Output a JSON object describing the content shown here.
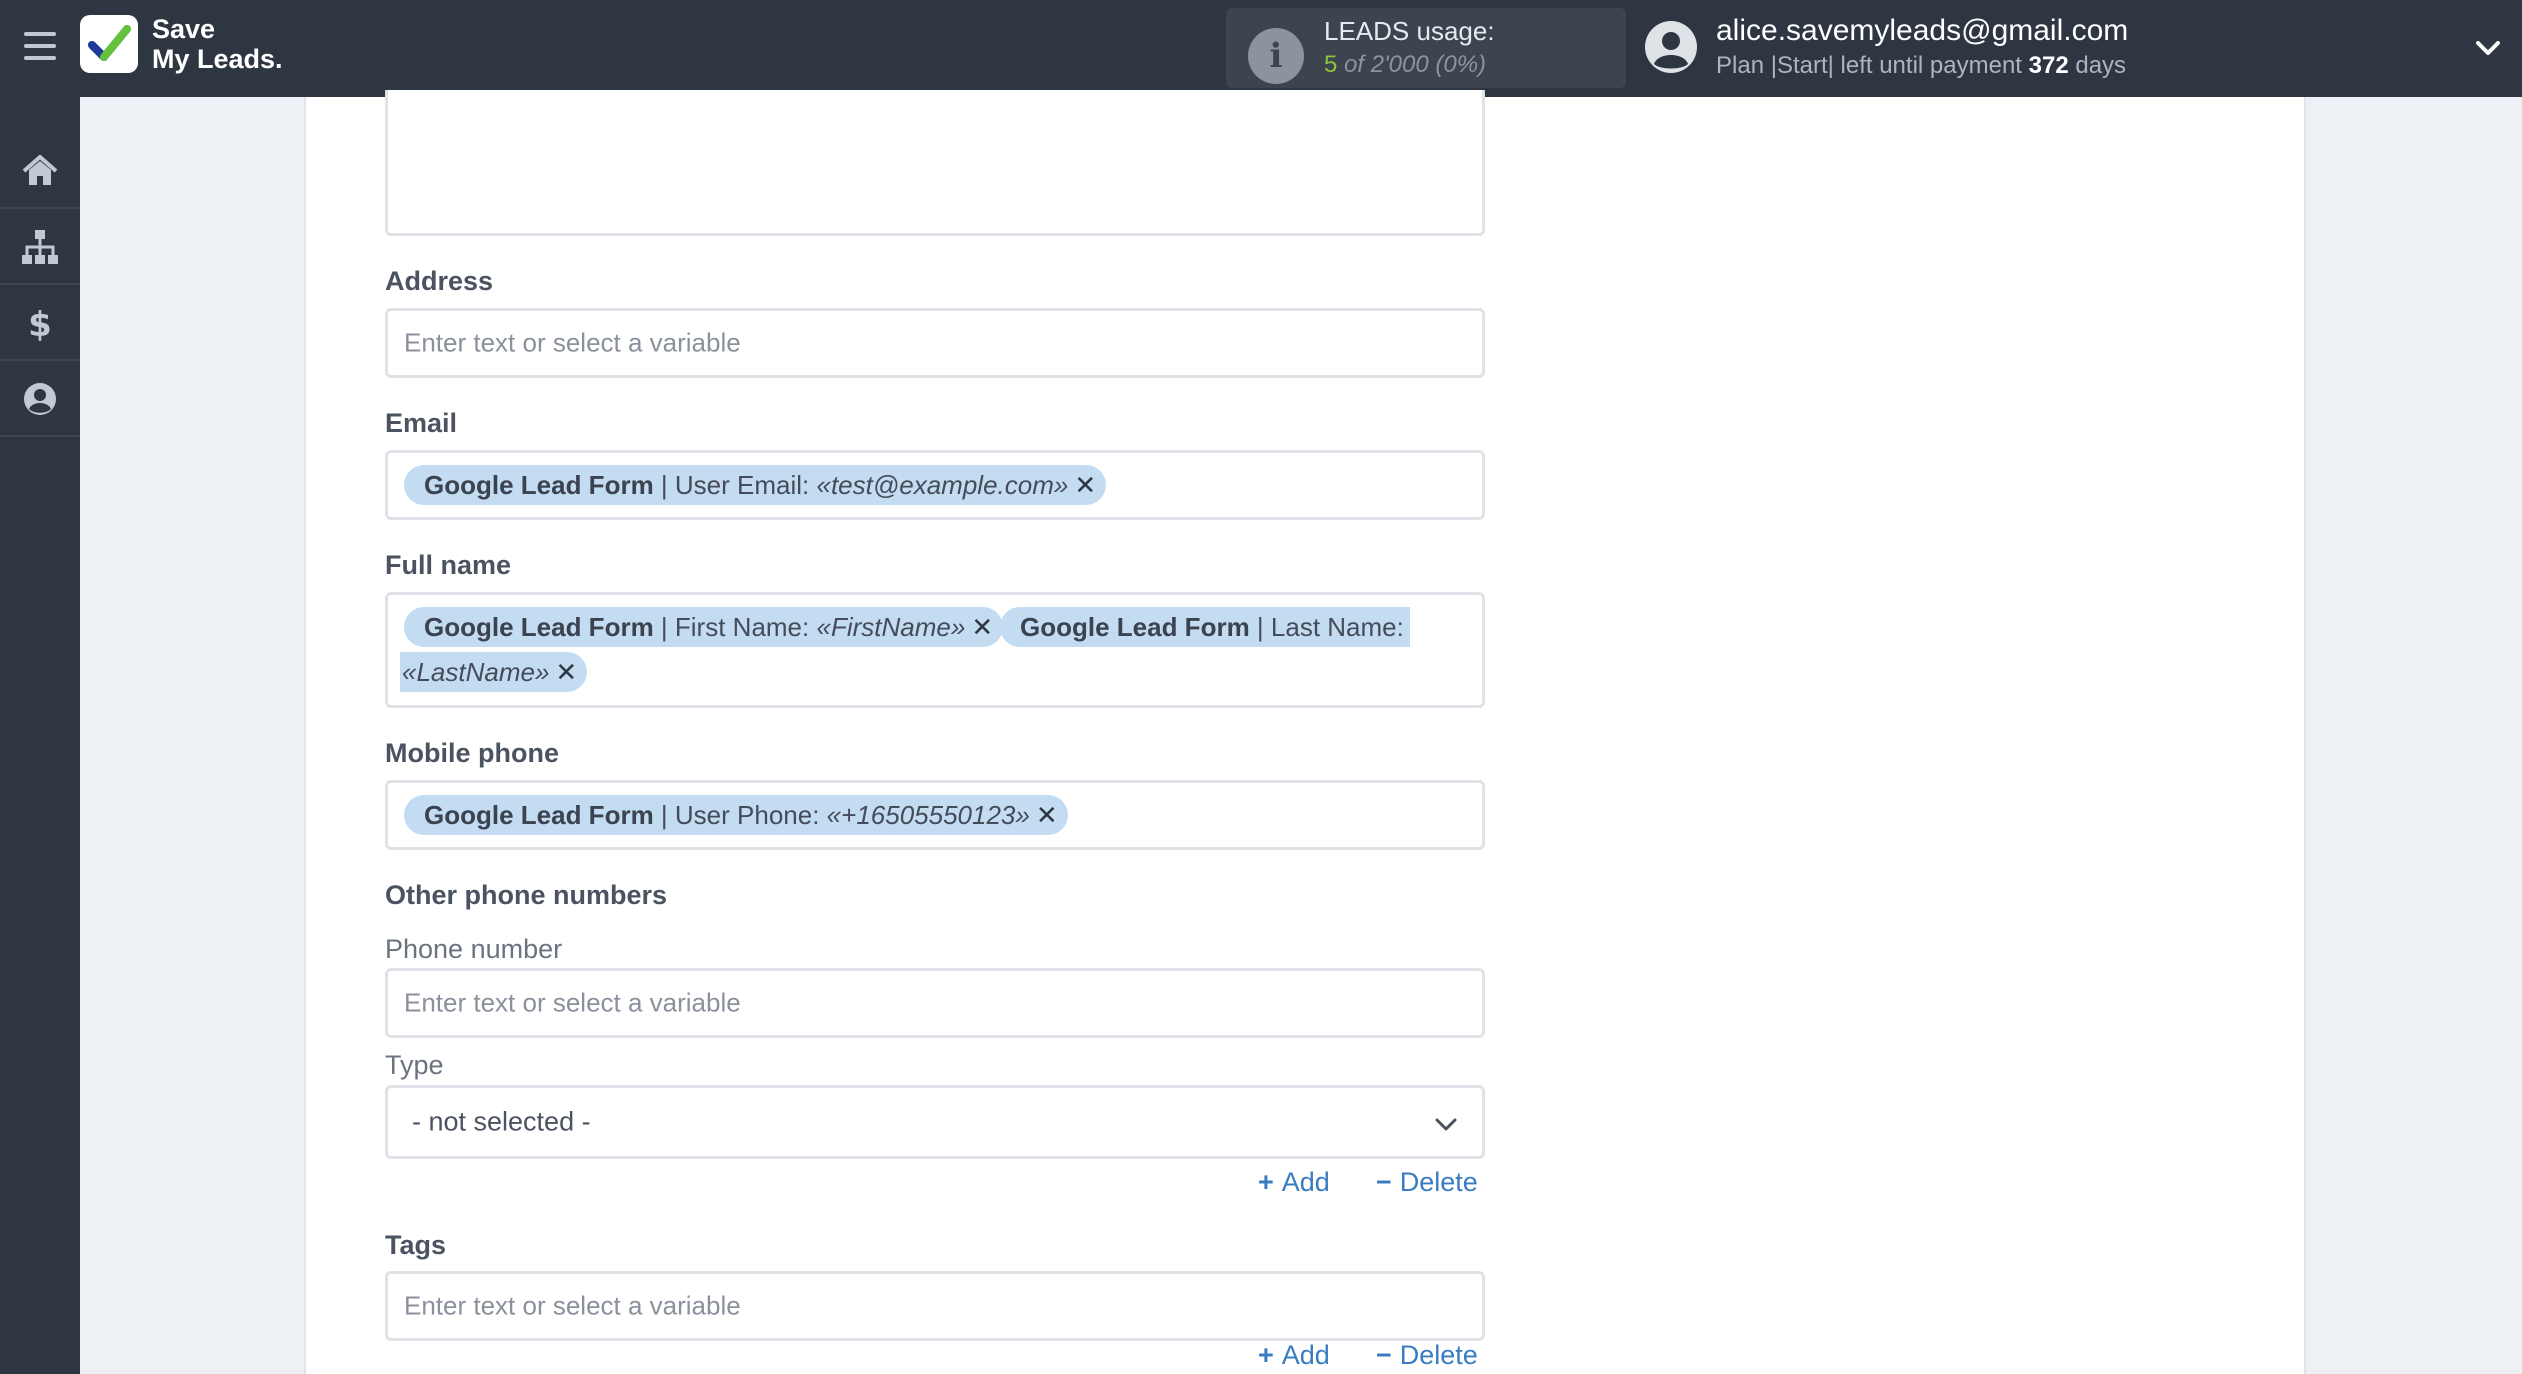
{
  "header": {
    "logo_line1": "Save",
    "logo_line2": "My Leads.",
    "usage_title": "LEADS usage:",
    "usage_count": "5",
    "usage_of": "of 2'000",
    "usage_percent": "(0%)",
    "user_email": "alice.savemyleads@gmail.com",
    "plan_prefix": "Plan |Start| left until payment",
    "plan_days": "372",
    "plan_suffix": "days"
  },
  "sidebar": {
    "items": [
      {
        "icon": "home-icon"
      },
      {
        "icon": "sitemap-icon"
      },
      {
        "icon": "dollar-icon"
      },
      {
        "icon": "user-circle-icon"
      }
    ]
  },
  "form": {
    "address": {
      "label": "Address",
      "placeholder": "Enter text or select a variable"
    },
    "email": {
      "label": "Email",
      "tags": [
        {
          "source": "Google Lead Form",
          "field": "| User Email:",
          "value": "«test@example.com»"
        }
      ]
    },
    "full_name": {
      "label": "Full name",
      "tags": [
        {
          "source": "Google Lead Form",
          "field": "| First Name:",
          "value": "«FirstName»"
        },
        {
          "source": "Google Lead Form",
          "field": "| Last Name:",
          "value": "«LastName»"
        }
      ]
    },
    "mobile_phone": {
      "label": "Mobile phone",
      "tags": [
        {
          "source": "Google Lead Form",
          "field": "| User Phone:",
          "value": "«+16505550123»"
        }
      ]
    },
    "other_phones": {
      "label": "Other phone numbers",
      "phone_label": "Phone number",
      "phone_placeholder": "Enter text or select a variable",
      "type_label": "Type",
      "type_value": "- not selected -",
      "add_label": "Add",
      "delete_label": "Delete"
    },
    "tags": {
      "label": "Tags",
      "placeholder": "Enter text or select a variable",
      "add_label": "Add",
      "delete_label": "Delete"
    }
  },
  "colors": {
    "topbar": "#2e3642",
    "tag_bg": "#c4dcf2",
    "link": "#3a7cc2",
    "usage_green": "#8fc43a"
  }
}
